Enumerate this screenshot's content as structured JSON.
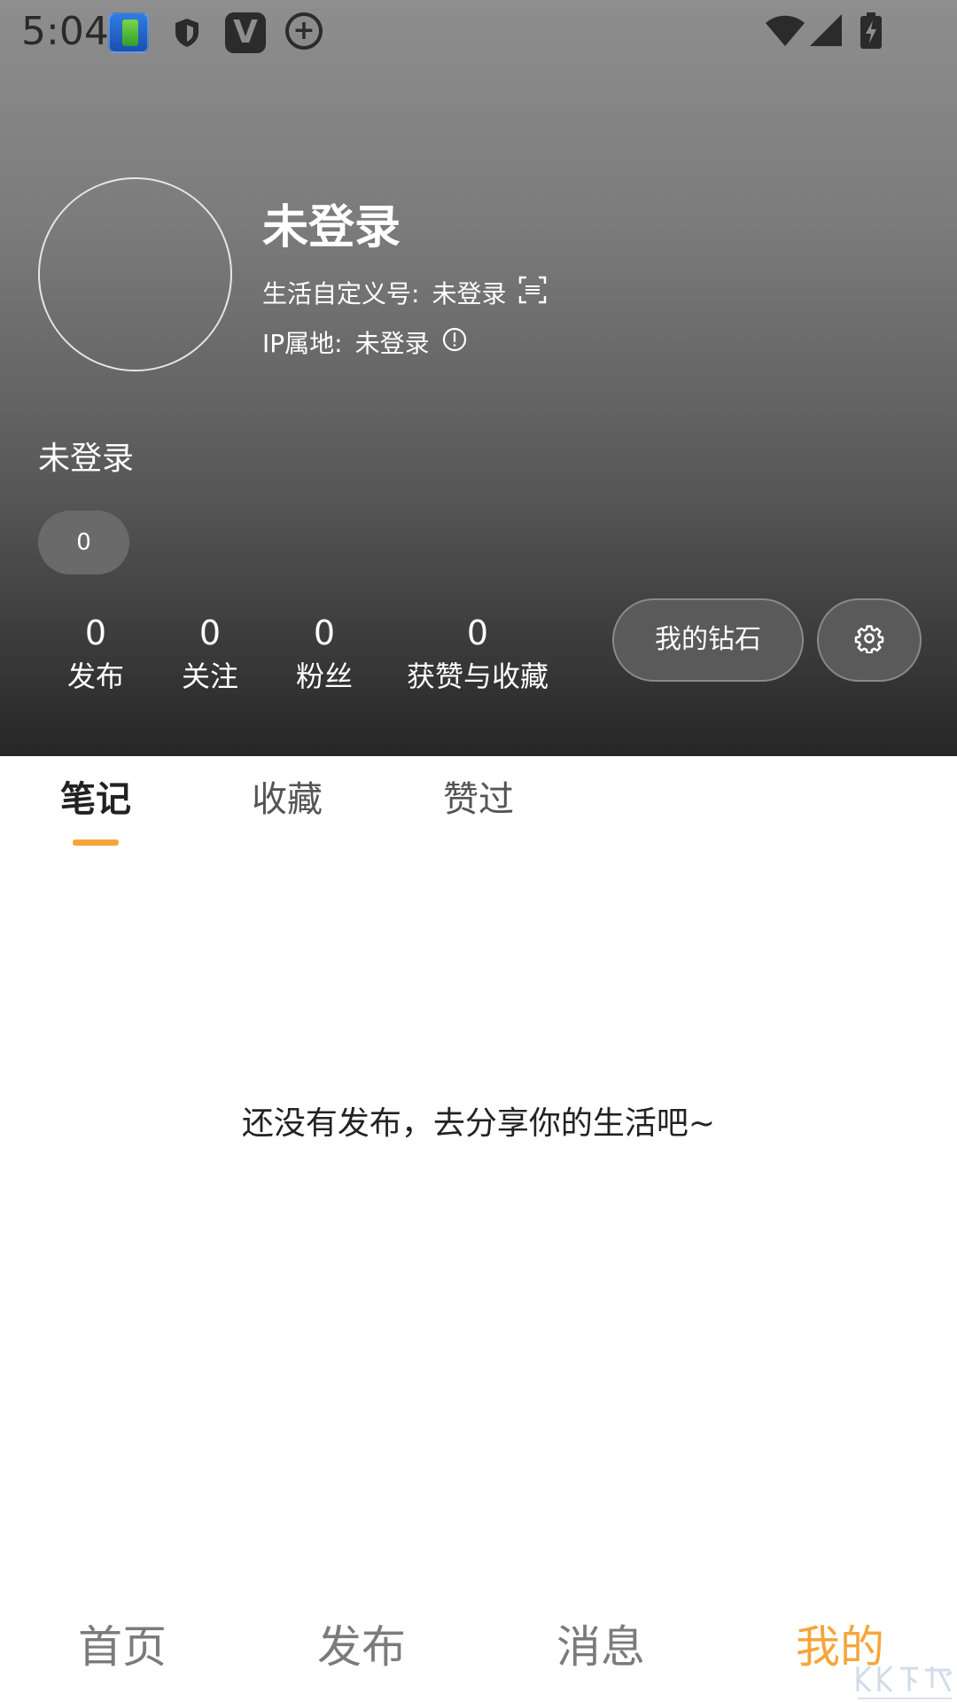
{
  "status_bar": {
    "time": "5:04"
  },
  "profile": {
    "name": "未登录",
    "custom_id_label": "生活自定义号:",
    "custom_id_value": "未登录",
    "ip_label": "IP属地:",
    "ip_value": "未登录",
    "bio": "未登录",
    "pill_count": "0"
  },
  "stats": [
    {
      "value": "0",
      "label": "发布"
    },
    {
      "value": "0",
      "label": "关注"
    },
    {
      "value": "0",
      "label": "粉丝"
    },
    {
      "value": "0",
      "label": "获赞与收藏"
    }
  ],
  "actions": {
    "diamond_label": "我的钻石"
  },
  "tabs": [
    {
      "label": "笔记",
      "active": true
    },
    {
      "label": "收藏",
      "active": false
    },
    {
      "label": "赞过",
      "active": false
    }
  ],
  "empty_state": "还没有发布，去分享你的生活吧~",
  "bottom_nav": [
    {
      "label": "首页",
      "active": false
    },
    {
      "label": "发布",
      "active": false
    },
    {
      "label": "消息",
      "active": false
    },
    {
      "label": "我的",
      "active": true
    }
  ],
  "colors": {
    "accent": "#f7a53a",
    "header_top": "#8e8e8e",
    "header_bottom": "#262626"
  }
}
